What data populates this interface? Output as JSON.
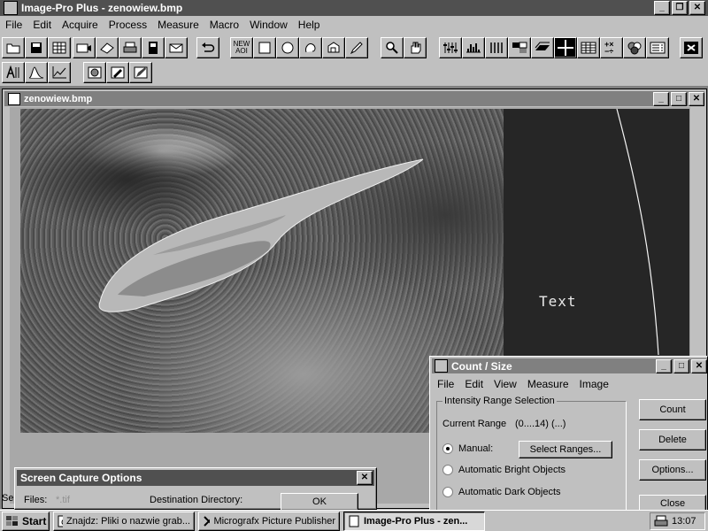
{
  "app": {
    "title": "Image-Pro Plus - zenowiew.bmp",
    "menu": [
      "File",
      "Edit",
      "Acquire",
      "Process",
      "Measure",
      "Macro",
      "Window",
      "Help"
    ]
  },
  "toolbar": {
    "new_aoi_label": "NEW\nAOI"
  },
  "image_window": {
    "title": "zenowiew.bmp",
    "overlay_text": "Text"
  },
  "count_size": {
    "title": "Count / Size",
    "menu": [
      "File",
      "Edit",
      "View",
      "Measure",
      "Image"
    ],
    "group_title": "Intensity Range Selection",
    "current_range_label": "Current Range",
    "current_range_value": "(0....14) (...)",
    "manual_label": "Manual:",
    "select_ranges_label": "Select Ranges...",
    "auto_bright_label": "Automatic Bright Objects",
    "auto_dark_label": "Automatic Dark Objects",
    "count_label": "Count",
    "delete_label": "Delete",
    "options_label": "Options...",
    "close_label": "Close"
  },
  "capture_dialog": {
    "title": "Screen Capture Options",
    "files_label": "Files:",
    "files_value": "*.tif",
    "dest_label": "Destination Directory:",
    "ok_label": "OK"
  },
  "status_fragment": "Se",
  "taskbar": {
    "start_label": "Start",
    "tasks": [
      "Znajdz: Pliki o nazwie grab...",
      "Micrografx Picture Publisher",
      "Image-Pro Plus - zen..."
    ],
    "clock": "13:07"
  }
}
